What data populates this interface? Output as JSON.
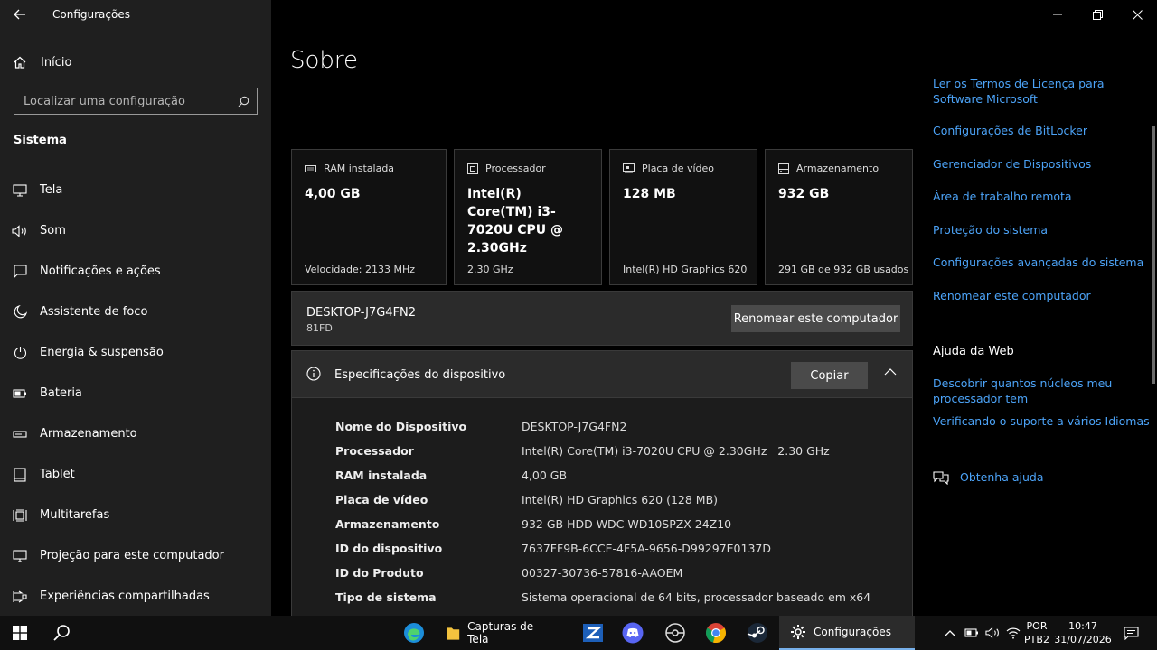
{
  "window": {
    "title": "Configurações"
  },
  "sidebar": {
    "home_label": "Início",
    "search_placeholder": "Localizar uma configuração",
    "section": "Sistema",
    "items": [
      {
        "label": "Tela",
        "icon": "monitor-icon"
      },
      {
        "label": "Som",
        "icon": "speaker-icon"
      },
      {
        "label": "Notificações e ações",
        "icon": "notification-icon"
      },
      {
        "label": "Assistente de foco",
        "icon": "moon-icon"
      },
      {
        "label": "Energia & suspensão",
        "icon": "power-icon"
      },
      {
        "label": "Bateria",
        "icon": "battery-icon"
      },
      {
        "label": "Armazenamento",
        "icon": "storage-icon"
      },
      {
        "label": "Tablet",
        "icon": "tablet-icon"
      },
      {
        "label": "Multitarefas",
        "icon": "multitask-icon"
      },
      {
        "label": "Projeção para este computador",
        "icon": "projection-icon"
      },
      {
        "label": "Experiências compartilhadas",
        "icon": "share-icon"
      }
    ]
  },
  "main": {
    "title": "Sobre",
    "cards": [
      {
        "label": "RAM instalada",
        "value": "4,00 GB",
        "footer": "Velocidade: 2133 MHz",
        "icon": "ram-icon"
      },
      {
        "label": "Processador",
        "value": "Intel(R) Core(TM) i3-7020U CPU @ 2.30GHz",
        "footer": "2.30 GHz",
        "icon": "cpu-icon"
      },
      {
        "label": "Placa de vídeo",
        "value": "128 MB",
        "footer": "Intel(R) HD Graphics 620",
        "icon": "gpu-icon"
      },
      {
        "label": "Armazenamento",
        "value": "932 GB",
        "footer": "291 GB de 932 GB usados",
        "icon": "disk-icon"
      }
    ],
    "pc": {
      "name": "DESKTOP-J7G4FN2",
      "model": "81FD",
      "rename_label": "Renomear este computador"
    },
    "specs": {
      "title": "Especificações do dispositivo",
      "copy_label": "Copiar",
      "rows": [
        {
          "k": "Nome do Dispositivo",
          "v": "DESKTOP-J7G4FN2"
        },
        {
          "k": "Processador",
          "v": "Intel(R) Core(TM) i3-7020U CPU @ 2.30GHz   2.30 GHz"
        },
        {
          "k": "RAM instalada",
          "v": "4,00 GB"
        },
        {
          "k": "Placa de vídeo",
          "v": "Intel(R) HD Graphics 620 (128 MB)"
        },
        {
          "k": "Armazenamento",
          "v": "932 GB HDD WDC WD10SPZX-24Z10"
        },
        {
          "k": "ID do dispositivo",
          "v": "7637FF9B-6CCE-4F5A-9656-D99297E0137D"
        },
        {
          "k": "ID do Produto",
          "v": "00327-30736-57816-AAOEM"
        },
        {
          "k": "Tipo de sistema",
          "v": "Sistema operacional de 64 bits, processador baseado em x64"
        }
      ]
    }
  },
  "related": {
    "links": [
      "Ler os Termos de Licença para Software Microsoft",
      "Configurações de BitLocker",
      "Gerenciador de Dispositivos",
      "Área de trabalho remota",
      "Proteção do sistema",
      "Configurações avançadas do sistema",
      "Renomear este computador"
    ],
    "web_heading": "Ajuda da Web",
    "web_links": [
      "Descobrir quantos núcleos meu processador tem",
      "Verificando o suporte a vários Idiomas"
    ],
    "help_label": "Obtenha ajuda"
  },
  "taskbar": {
    "explorer_label": "Capturas de Tela",
    "settings_label": "Configurações",
    "lang_top": "POR",
    "lang_bottom": "PTB2",
    "time": "10:47",
    "date": "31/07/2026"
  },
  "colors": {
    "accent": "#4ca3f7",
    "sidebar_bg": "#1f1f1f",
    "main_bg": "#000000"
  }
}
